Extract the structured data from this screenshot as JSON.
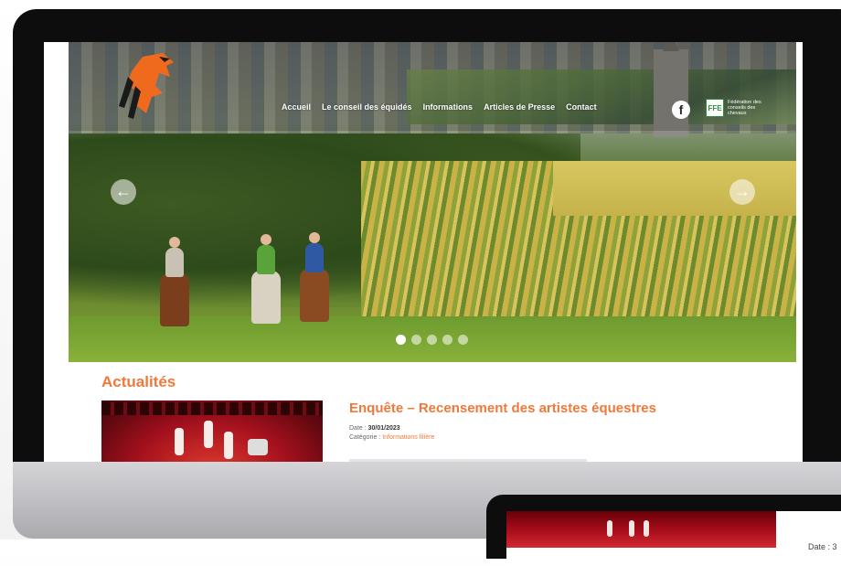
{
  "colors": {
    "accent": "#f0793a",
    "nav_text": "#ffffff",
    "bezel": "#0d0d0d"
  },
  "header": {
    "logo_icon": "horse-logo-icon",
    "nav": [
      "Accueil",
      "Le conseil des équidés",
      "Informations",
      "Articles de Presse",
      "Contact"
    ],
    "facebook_icon": "facebook-icon",
    "facebook_glyph": "f",
    "ffe_logo_text": "Fédération des conseils des chevaux"
  },
  "carousel": {
    "prev_icon": "chevron-left-icon",
    "next_icon": "chevron-right-icon",
    "prev_glyph": "←",
    "next_glyph": "→",
    "slides_count": 5,
    "active_slide": 1
  },
  "news": {
    "section_title": "Actualités",
    "article_title": "Enquête – Recensement des artistes équestres",
    "date_label": "Date :",
    "date_value": "30/01/2023",
    "category_label": "Catégorie :",
    "category_value": "Informations filière"
  },
  "second_device": {
    "date_label": "Date : 3"
  }
}
